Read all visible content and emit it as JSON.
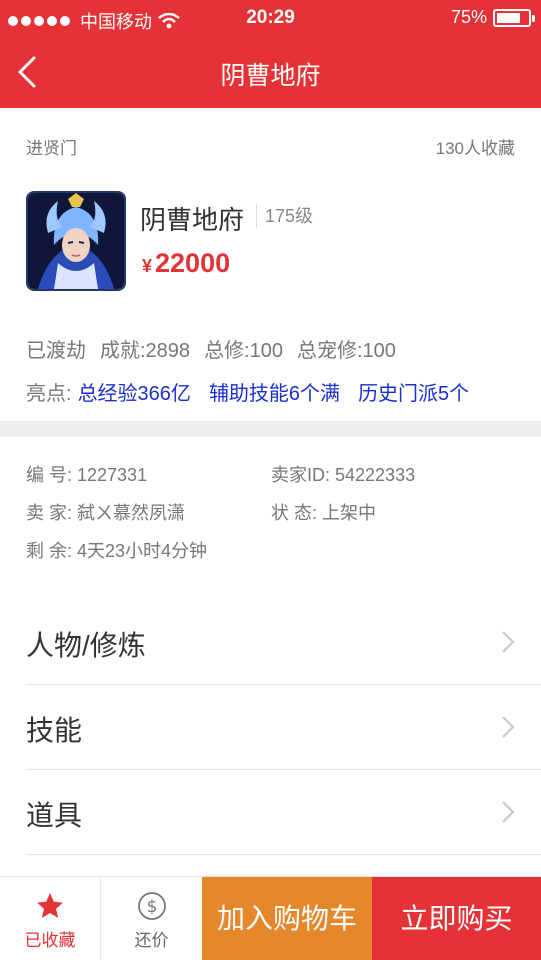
{
  "status_bar": {
    "carrier": "中国移动",
    "time": "20:29",
    "battery": "75%",
    "battery_level": 0.75
  },
  "nav": {
    "title": "阴曹地府",
    "back_icon": "chevron-left-icon"
  },
  "listing": {
    "shop": "进贤门",
    "favorites": "130人收藏",
    "character_name": "阴曹地府",
    "level": "175级",
    "price_symbol": "¥",
    "price": "22000",
    "stats": [
      "已渡劫",
      "成就:2898",
      "总修:100",
      "总宠修:100"
    ],
    "highlight_label": "亮点:",
    "highlights": [
      "总经验366亿",
      "辅助技能6个满",
      "历史门派5个"
    ]
  },
  "info": {
    "id": "编  号: 1227331",
    "seller_id": "卖家ID: 54222333",
    "seller": "卖  家: 弑ㄨ慕然夙潇",
    "status": "状  态: 上架中",
    "remaining": "剩  余: 4天23小时4分钟"
  },
  "menu": [
    {
      "label": "人物/修炼"
    },
    {
      "label": "技能"
    },
    {
      "label": "道具"
    }
  ],
  "footer": {
    "favorited": "已收藏",
    "bargain": "还价",
    "add_to_cart": "加入购物车",
    "buy_now": "立即购买"
  },
  "colors": {
    "header_red": "#e53236",
    "cart_orange": "#e5872b",
    "highlight_blue": "#1a2fd0"
  }
}
